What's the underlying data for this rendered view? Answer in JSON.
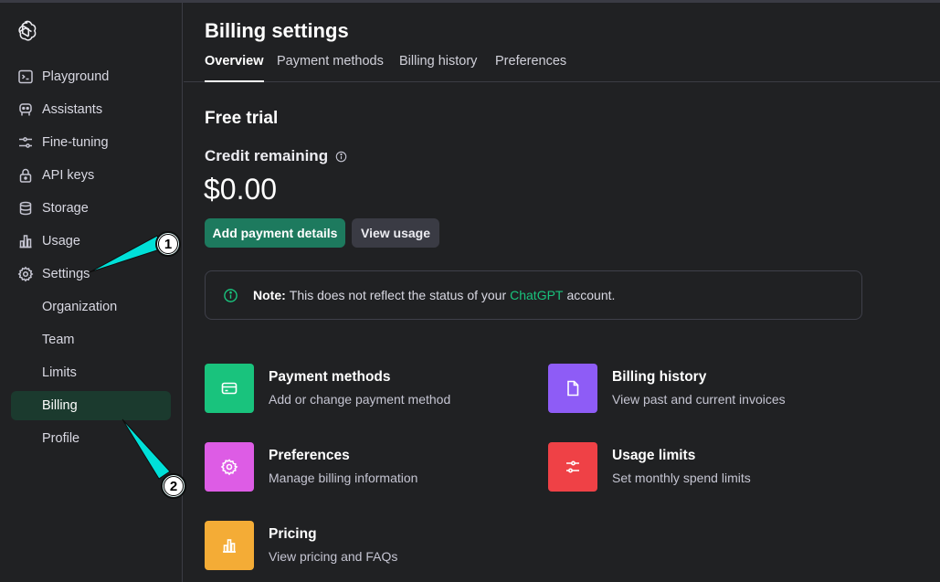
{
  "sidebar": {
    "items": [
      {
        "label": "Playground",
        "icon": "terminal-icon"
      },
      {
        "label": "Assistants",
        "icon": "robot-icon"
      },
      {
        "label": "Fine-tuning",
        "icon": "sliders-icon"
      },
      {
        "label": "API keys",
        "icon": "lock-icon"
      },
      {
        "label": "Storage",
        "icon": "database-icon"
      },
      {
        "label": "Usage",
        "icon": "bar-chart-icon"
      },
      {
        "label": "Settings",
        "icon": "gear-icon"
      }
    ],
    "subitems": [
      {
        "label": "Organization"
      },
      {
        "label": "Team"
      },
      {
        "label": "Limits"
      },
      {
        "label": "Billing",
        "active": true
      },
      {
        "label": "Profile"
      }
    ]
  },
  "header": {
    "title": "Billing settings",
    "tabs": [
      {
        "label": "Overview",
        "active": true
      },
      {
        "label": "Payment methods"
      },
      {
        "label": "Billing history"
      },
      {
        "label": "Preferences"
      }
    ]
  },
  "overview": {
    "section_title": "Free trial",
    "credit_label": "Credit remaining",
    "credit_value": "$0.00",
    "add_payment_label": "Add payment details",
    "view_usage_label": "View usage",
    "note": {
      "prefix": "Note:",
      "text_before": "This does not reflect the status of your",
      "link": "ChatGPT",
      "text_after": "account."
    }
  },
  "cards": [
    {
      "title": "Payment methods",
      "desc": "Add or change payment method",
      "color": "#19c37d",
      "icon": "credit-card-icon"
    },
    {
      "title": "Billing history",
      "desc": "View past and current invoices",
      "color": "#8e5cf6",
      "icon": "document-icon"
    },
    {
      "title": "Preferences",
      "desc": "Manage billing information",
      "color": "#dd5ce5",
      "icon": "gear-icon"
    },
    {
      "title": "Usage limits",
      "desc": "Set monthly spend limits",
      "color": "#ef4146",
      "icon": "sliders-icon"
    },
    {
      "title": "Pricing",
      "desc": "View pricing and FAQs",
      "color": "#f4ac36",
      "icon": "bar-chart-icon"
    }
  ],
  "annotations": [
    {
      "label": "1"
    },
    {
      "label": "2"
    }
  ],
  "colors": {
    "accent": "#19c37d",
    "primary_button": "#1d7a5e",
    "active_nav": "#1b3a2e",
    "callout": "#00e0d8"
  }
}
